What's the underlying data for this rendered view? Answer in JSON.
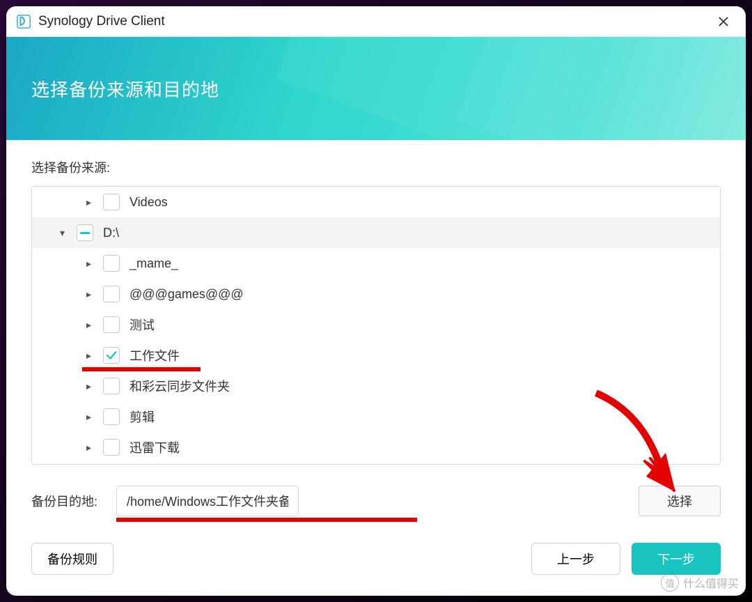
{
  "titlebar": {
    "app_title": "Synology Drive Client"
  },
  "banner": {
    "heading": "选择备份来源和目的地"
  },
  "source": {
    "label": "选择备份来源:",
    "items": [
      {
        "label": "Videos",
        "depth": 2,
        "state": "unchecked",
        "expand": "collapsed"
      },
      {
        "label": "D:\\",
        "depth": 1,
        "state": "indeterminate",
        "expand": "expanded",
        "drive": true
      },
      {
        "label": "_mame_",
        "depth": 2,
        "state": "unchecked",
        "expand": "collapsed"
      },
      {
        "label": "@@@games@@@",
        "depth": 2,
        "state": "unchecked",
        "expand": "collapsed"
      },
      {
        "label": "测试",
        "depth": 2,
        "state": "unchecked",
        "expand": "collapsed"
      },
      {
        "label": "工作文件",
        "depth": 2,
        "state": "checked",
        "expand": "collapsed"
      },
      {
        "label": "和彩云同步文件夹",
        "depth": 2,
        "state": "unchecked",
        "expand": "collapsed"
      },
      {
        "label": "剪辑",
        "depth": 2,
        "state": "unchecked",
        "expand": "collapsed"
      },
      {
        "label": "迅雷下载",
        "depth": 2,
        "state": "unchecked",
        "expand": "collapsed"
      }
    ]
  },
  "destination": {
    "label": "备份目的地:",
    "value": "/home/Windows工作文件夹备份/Z-SERVER",
    "select_button": "选择"
  },
  "footer": {
    "rules": "备份规则",
    "prev": "上一步",
    "next": "下一步"
  },
  "watermark": {
    "icon": "值",
    "text": "什么值得买"
  }
}
